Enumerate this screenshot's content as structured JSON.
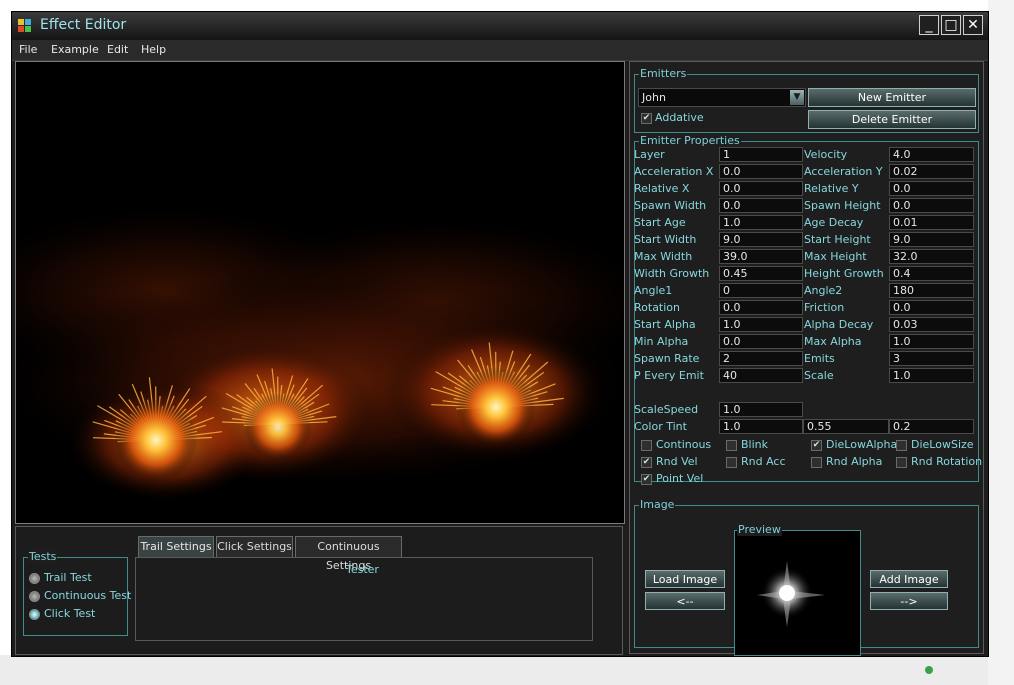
{
  "window": {
    "title": "Effect Editor"
  },
  "window_controls": {
    "minimize": "_",
    "maximize": "□",
    "close": "✕"
  },
  "menu": [
    "File",
    "Example",
    "Edit",
    "Help"
  ],
  "emitters": {
    "title": "Emitters",
    "selected": "John",
    "new_button": "New Emitter",
    "delete_button": "Delete Emitter",
    "additive_label": "Addative",
    "additive_checked": true
  },
  "properties": {
    "title": "Emitter Properties",
    "rows": [
      {
        "l1": "Layer",
        "v1": "1",
        "l2": "Velocity",
        "v2": "4.0"
      },
      {
        "l1": "Acceleration X",
        "v1": "0.0",
        "l2": "Acceleration Y",
        "v2": "0.02"
      },
      {
        "l1": "Relative X",
        "v1": "0.0",
        "l2": "Relative Y",
        "v2": "0.0"
      },
      {
        "l1": "Spawn Width",
        "v1": "0.0",
        "l2": "Spawn Height",
        "v2": "0.0"
      },
      {
        "l1": "Start Age",
        "v1": "1.0",
        "l2": "Age Decay",
        "v2": "0.01"
      },
      {
        "l1": "Start Width",
        "v1": "9.0",
        "l2": "Start Height",
        "v2": "9.0"
      },
      {
        "l1": "Max Width",
        "v1": "39.0",
        "l2": "Max Height",
        "v2": "32.0"
      },
      {
        "l1": "Width Growth",
        "v1": "0.45",
        "l2": "Height Growth",
        "v2": "0.4"
      },
      {
        "l1": "Angle1",
        "v1": "0",
        "l2": "Angle2",
        "v2": "180"
      },
      {
        "l1": "Rotation",
        "v1": "0.0",
        "l2": "Friction",
        "v2": "0.0"
      },
      {
        "l1": "Start Alpha",
        "v1": "1.0",
        "l2": "Alpha Decay",
        "v2": "0.03"
      },
      {
        "l1": "Min Alpha",
        "v1": "0.0",
        "l2": "Max Alpha",
        "v2": "1.0"
      },
      {
        "l1": "Spawn Rate",
        "v1": "2",
        "l2": "Emits",
        "v2": "3"
      },
      {
        "l1": "P Every Emit",
        "v1": "40",
        "l2": "Scale",
        "v2": "1.0"
      }
    ],
    "scale_speed_label": "ScaleSpeed",
    "scale_speed": "1.0",
    "color_tint_label": "Color Tint",
    "color_tint": [
      "1.0",
      "0.55",
      "0.2"
    ],
    "checkboxes": [
      {
        "label": "Continous",
        "checked": false
      },
      {
        "label": "Blink",
        "checked": false
      },
      {
        "label": "DieLowAlpha",
        "checked": true
      },
      {
        "label": "DieLowSize",
        "checked": false
      },
      {
        "label": "Rnd Vel",
        "checked": true
      },
      {
        "label": "Rnd Acc",
        "checked": false
      },
      {
        "label": "Rnd Alpha",
        "checked": false
      },
      {
        "label": "Rnd Rotation",
        "checked": false
      },
      {
        "label": "Point Vel",
        "checked": true
      }
    ]
  },
  "image": {
    "title": "Image",
    "preview_title": "Preview",
    "load_button": "Load Image",
    "prev_button": "<--",
    "add_button": "Add Image",
    "next_button": "-->"
  },
  "tests": {
    "title": "Tests",
    "options": [
      "Trail Test",
      "Continuous Test",
      "Click Test"
    ],
    "selected_index": 2
  },
  "tabs": [
    "Trail Settings",
    "Click Settings",
    "Continuous Settings"
  ],
  "active_tab": 0,
  "tab_content": {
    "text": "Tester"
  },
  "colors": {
    "accent": "#86d8de",
    "title": "#9fe3ef",
    "border": "#3f8c8c"
  }
}
